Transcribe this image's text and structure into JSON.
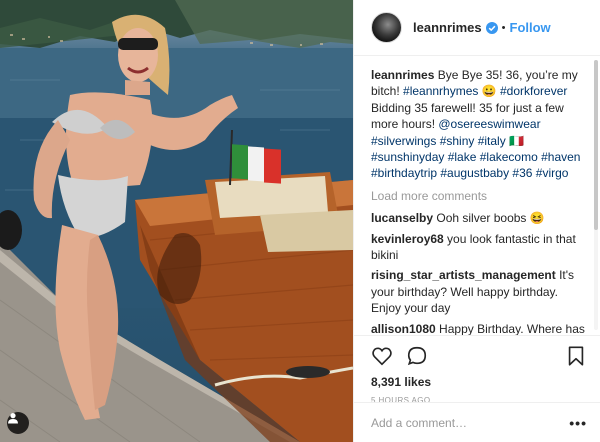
{
  "post": {
    "username": "leannrimes",
    "follow_label": "Follow",
    "separator": "•",
    "avatar_icon": "avatar-photo",
    "verified_icon": "verified-badge-icon",
    "accent_color": "#3897f0",
    "link_color": "#003569"
  },
  "caption": {
    "user": "leannrimes",
    "t1": " Bye Bye 35! 36, you’re my bitch! ",
    "tag1": "#leannrhymes",
    "emoji1": " 😀 ",
    "tag2": "#dorkforever",
    "t2": " Bidding 35 farewell! 35 for just a few more hours! ",
    "mention": "@osereeswimwear",
    "tags_line": "#silverwings #shiny #italy",
    "flag": " 🇮🇹 ",
    "tags_line2": "#sunshinyday #lake #lakecomo #haven #birthdaytrip #augustbaby #36 #virgo"
  },
  "load_more": "Load more comments",
  "comments": [
    {
      "user": "lucanselby",
      "text": " Ooh silver boobs 😆"
    },
    {
      "user": "kevinleroy68",
      "text": " you look fantastic in that bikini"
    },
    {
      "user": "rising_star_artists_management",
      "text": " It's your birthday? Well happy birthday. Enjoy your day"
    },
    {
      "user": "allison1080",
      "text": " Happy Birthday. Where has the time gone. I saw you the first time at the California State Fair the day after your 14th birthday. I think you'd been shooting a music video in San Francisco"
    }
  ],
  "stats": {
    "likes": "8,391 likes",
    "time": "5 HOURS AGO"
  },
  "composer": {
    "placeholder": "Add a comment…",
    "more_label": "•••"
  },
  "icons": {
    "like": "heart-icon",
    "comment": "comment-bubble-icon",
    "save": "bookmark-icon",
    "tagged_user": "person-icon"
  }
}
